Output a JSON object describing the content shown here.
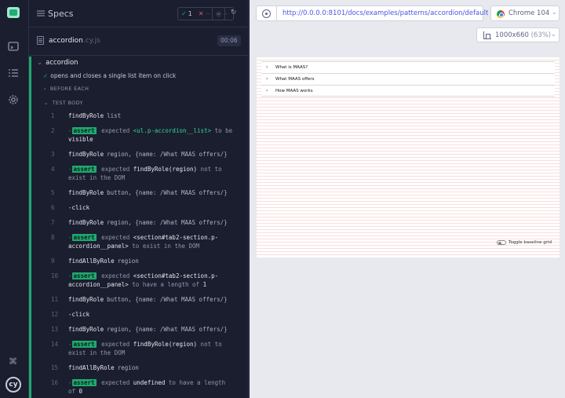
{
  "sidebar": {
    "icons": [
      "cypress-app-icon",
      "specs-list-icon",
      "runs-icon",
      "settings-icon",
      "keyboard-shortcuts-icon"
    ],
    "logo_text": "cy"
  },
  "specs_header": {
    "title": "Specs",
    "passed_count": "1",
    "failed_count": "--",
    "pending_count": "--"
  },
  "spec": {
    "name": "accordion",
    "extension": ".cy.js",
    "duration": "00:06"
  },
  "suite": {
    "name": "accordion",
    "test_title": "opens and closes a single list item on click",
    "before_each_label": "BEFORE EACH",
    "test_body_label": "TEST BODY",
    "assert_label": "assert",
    "commands": [
      {
        "num": "1",
        "name": "findByRole",
        "msg": "list"
      },
      {
        "num": "2",
        "assert": true,
        "parts": [
          [
            "m",
            "expected "
          ],
          [
            "g",
            "<ul.p-accordion__list>"
          ],
          [
            "m",
            " to be "
          ],
          [
            "w",
            "visible"
          ]
        ]
      },
      {
        "num": "3",
        "name": "findByRole",
        "msg": "region, {name: /What MAAS offers/}"
      },
      {
        "num": "4",
        "assert": true,
        "parts": [
          [
            "m",
            "expected "
          ],
          [
            "w",
            "findByRole(region)"
          ],
          [
            "m",
            " not to exist in the DOM"
          ]
        ]
      },
      {
        "num": "5",
        "name": "findByRole",
        "msg": "button, {name: /What MAAS offers/}"
      },
      {
        "num": "6",
        "name": "-click",
        "msg": ""
      },
      {
        "num": "7",
        "name": "findByRole",
        "msg": "region, {name: /What MAAS offers/}"
      },
      {
        "num": "8",
        "assert": true,
        "parts": [
          [
            "m",
            "expected "
          ],
          [
            "w",
            "<section#tab2-section.p-accordion__panel>"
          ],
          [
            "m",
            " to exist in the DOM"
          ]
        ]
      },
      {
        "num": "9",
        "name": "findAllByRole",
        "msg": "region"
      },
      {
        "num": "10",
        "assert": true,
        "parts": [
          [
            "m",
            "expected "
          ],
          [
            "w",
            "<section#tab2-section.p-accordion__panel>"
          ],
          [
            "m",
            " to have a length of "
          ],
          [
            "w",
            "1"
          ]
        ]
      },
      {
        "num": "11",
        "name": "findByRole",
        "msg": "button, {name: /What MAAS offers/}"
      },
      {
        "num": "12",
        "name": "-click",
        "msg": ""
      },
      {
        "num": "13",
        "name": "findByRole",
        "msg": "region, {name: /What MAAS offers/}"
      },
      {
        "num": "14",
        "assert": true,
        "parts": [
          [
            "m",
            "expected "
          ],
          [
            "w",
            "findByRole(region)"
          ],
          [
            "m",
            " not to exist in the DOM"
          ]
        ]
      },
      {
        "num": "15",
        "name": "findAllByRole",
        "msg": "region"
      },
      {
        "num": "16",
        "assert": true,
        "parts": [
          [
            "m",
            "expected "
          ],
          [
            "w",
            "undefined"
          ],
          [
            "m",
            " to have a length of "
          ],
          [
            "w",
            "0"
          ]
        ]
      }
    ]
  },
  "browser": {
    "url": "http://0.0.0.0:8101/docs/examples/patterns/accordion/default",
    "browser_label": "Chrome 104",
    "viewport_label": "1000x660",
    "viewport_pct": "(63%)"
  },
  "aut": {
    "accordion_items": [
      "What is MAAS?",
      "What MAAS offers",
      "How MAAS works"
    ],
    "toggle_label": "Toggle baseline grid"
  },
  "colors": {
    "pass": "#1fa971",
    "fail": "#e45770",
    "url": "#4956e3"
  }
}
